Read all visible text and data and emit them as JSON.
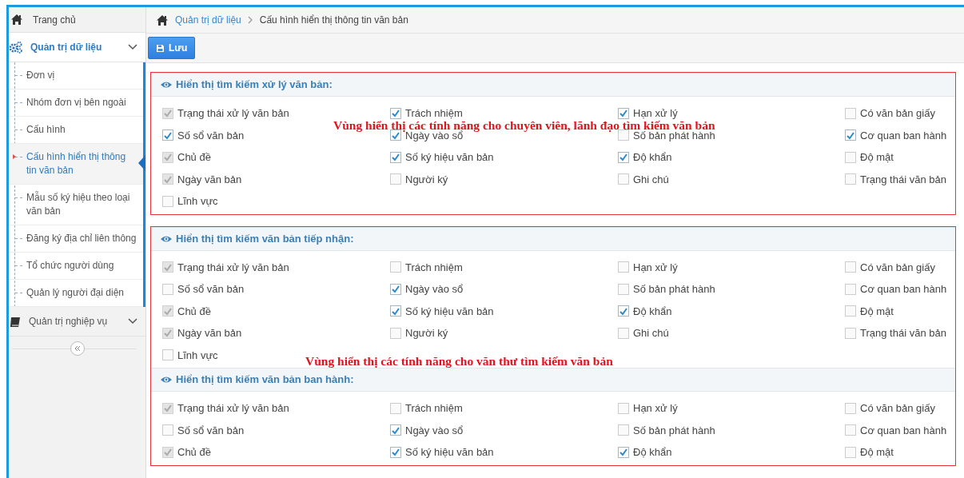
{
  "sidebar": {
    "items": [
      {
        "label": "Trang chủ",
        "kind": "link"
      },
      {
        "label": "Quản trị dữ liệu",
        "kind": "group",
        "expanded": true,
        "children": [
          {
            "label": "Đơn vị",
            "selected": false
          },
          {
            "label": "Nhóm đơn vị bên ngoài",
            "selected": false
          },
          {
            "label": "Cấu hình",
            "selected": false
          },
          {
            "label": "Cấu hình hiển thị thông tin văn bản",
            "selected": true
          },
          {
            "label": "Mẫu số ký hiệu theo loại văn bản",
            "selected": false
          },
          {
            "label": "Đăng ký địa chỉ liên thông",
            "selected": false
          },
          {
            "label": "Tổ chức người dùng",
            "selected": false
          },
          {
            "label": "Quản lý người đại diện",
            "selected": false
          }
        ]
      },
      {
        "label": "Quản trị nghiệp vụ",
        "kind": "group",
        "expanded": false
      }
    ]
  },
  "breadcrumb": [
    {
      "label": "Quản trị dữ liệu",
      "kind": "link"
    },
    {
      "label": "Cấu hình hiển thị thông tin văn bản",
      "kind": "current"
    }
  ],
  "toolbar": {
    "save_button": "Lưu"
  },
  "regions": [
    {
      "note": "Vùng hiển thị các tính năng cho chuyên viên, lãnh đạo tìm kiếm văn bản",
      "sections": [
        {
          "title": "Hiển thị tìm kiếm xử lý văn bản:",
          "options": [
            {
              "label": "Trạng thái xử lý văn bản",
              "checked": true,
              "disabled": true
            },
            {
              "label": "Trách nhiệm",
              "checked": true,
              "disabled": false
            },
            {
              "label": "Hạn xử lý",
              "checked": true,
              "disabled": false
            },
            {
              "label": "Có văn bản giấy",
              "checked": false,
              "disabled": false
            },
            {
              "label": "Số sổ văn bản",
              "checked": true,
              "disabled": false
            },
            {
              "label": "Ngày vào sổ",
              "checked": true,
              "disabled": false
            },
            {
              "label": "Số bản phát hành",
              "checked": false,
              "disabled": false
            },
            {
              "label": "Cơ quan ban hành",
              "checked": true,
              "disabled": false
            },
            {
              "label": "Chủ đề",
              "checked": true,
              "disabled": true
            },
            {
              "label": "Số ký hiệu văn bản",
              "checked": true,
              "disabled": false
            },
            {
              "label": "Độ khẩn",
              "checked": true,
              "disabled": false
            },
            {
              "label": "Độ mật",
              "checked": false,
              "disabled": false
            },
            {
              "label": "Ngày văn bản",
              "checked": true,
              "disabled": true
            },
            {
              "label": "Người ký",
              "checked": false,
              "disabled": false
            },
            {
              "label": "Ghi chú",
              "checked": false,
              "disabled": false
            },
            {
              "label": "Trạng thái văn bản",
              "checked": false,
              "disabled": false
            },
            {
              "label": "Lĩnh vực",
              "checked": false,
              "disabled": false
            }
          ]
        }
      ]
    },
    {
      "note": "Vùng hiển thị các tính năng cho văn thư tìm kiếm văn bản",
      "sections": [
        {
          "title": "Hiển thị tìm kiếm văn bản tiếp nhận:",
          "options": [
            {
              "label": "Trạng thái xử lý văn bản",
              "checked": true,
              "disabled": true
            },
            {
              "label": "Trách nhiệm",
              "checked": false,
              "disabled": false
            },
            {
              "label": "Hạn xử lý",
              "checked": false,
              "disabled": false
            },
            {
              "label": "Có văn bản giấy",
              "checked": false,
              "disabled": false
            },
            {
              "label": "Số sổ văn bản",
              "checked": false,
              "disabled": false
            },
            {
              "label": "Ngày vào sổ",
              "checked": true,
              "disabled": false
            },
            {
              "label": "Số bản phát hành",
              "checked": false,
              "disabled": false
            },
            {
              "label": "Cơ quan ban hành",
              "checked": false,
              "disabled": false
            },
            {
              "label": "Chủ đề",
              "checked": true,
              "disabled": true
            },
            {
              "label": "Số ký hiệu văn bản",
              "checked": true,
              "disabled": false
            },
            {
              "label": "Độ khẩn",
              "checked": true,
              "disabled": false
            },
            {
              "label": "Độ mật",
              "checked": false,
              "disabled": false
            },
            {
              "label": "Ngày văn bản",
              "checked": true,
              "disabled": true
            },
            {
              "label": "Người ký",
              "checked": false,
              "disabled": false
            },
            {
              "label": "Ghi chú",
              "checked": false,
              "disabled": false
            },
            {
              "label": "Trạng thái văn bản",
              "checked": false,
              "disabled": false
            },
            {
              "label": "Lĩnh vực",
              "checked": false,
              "disabled": false
            }
          ]
        },
        {
          "title": "Hiển thị tìm kiếm văn bản ban hành:",
          "options": [
            {
              "label": "Trạng thái xử lý văn bản",
              "checked": true,
              "disabled": true
            },
            {
              "label": "Trách nhiệm",
              "checked": false,
              "disabled": false
            },
            {
              "label": "Hạn xử lý",
              "checked": false,
              "disabled": false
            },
            {
              "label": "Có văn bản giấy",
              "checked": false,
              "disabled": false
            },
            {
              "label": "Số sổ văn bản",
              "checked": false,
              "disabled": false
            },
            {
              "label": "Ngày vào sổ",
              "checked": true,
              "disabled": false
            },
            {
              "label": "Số bản phát hành",
              "checked": false,
              "disabled": false
            },
            {
              "label": "Cơ quan ban hành",
              "checked": false,
              "disabled": false
            },
            {
              "label": "Chủ đề",
              "checked": true,
              "disabled": true
            },
            {
              "label": "Số ký hiệu văn bản",
              "checked": true,
              "disabled": false
            },
            {
              "label": "Độ khẩn",
              "checked": true,
              "disabled": false
            },
            {
              "label": "Độ mật",
              "checked": false,
              "disabled": false
            }
          ]
        }
      ]
    }
  ]
}
